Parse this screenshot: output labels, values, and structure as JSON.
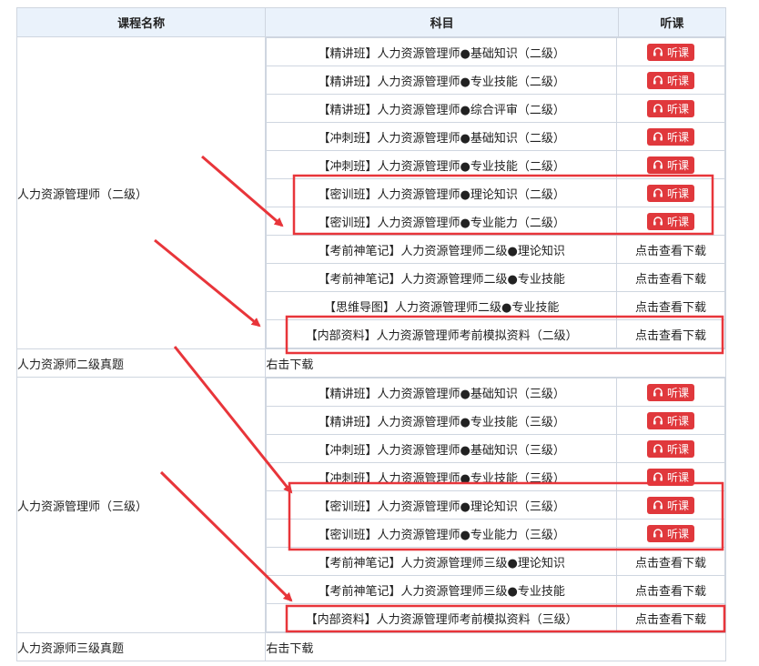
{
  "header": {
    "course_name": "课程名称",
    "subject": "科目",
    "listen": "听课"
  },
  "listen_label": "听课",
  "accent_color": "#e0383c",
  "groups": [
    {
      "name": "人力资源管理师（二级）",
      "rows": [
        {
          "subject": "【精讲班】人力资源管理师●基础知识（二级）",
          "action": "听课"
        },
        {
          "subject": "【精讲班】人力资源管理师●专业技能（二级）",
          "action": "听课"
        },
        {
          "subject": "【精讲班】人力资源管理师●综合评审（二级）",
          "action": "听课"
        },
        {
          "subject": "【冲刺班】人力资源管理师●基础知识（二级）",
          "action": "听课"
        },
        {
          "subject": "【冲刺班】人力资源管理师●专业技能（二级）",
          "action": "听课"
        },
        {
          "subject": "【密训班】人力资源管理师●理论知识（二级）",
          "action": "听课"
        },
        {
          "subject": "【密训班】人力资源管理师●专业能力（二级）",
          "action": "听课"
        },
        {
          "subject": "【考前神笔记】人力资源管理师二级●理论知识",
          "action": "点击查看下载"
        },
        {
          "subject": "【考前神笔记】人力资源管理师二级●专业技能",
          "action": "点击查看下载"
        },
        {
          "subject": "【思维导图】人力资源管理师二级●专业技能",
          "action": "点击查看下载"
        },
        {
          "subject": "【内部资料】人力资源管理师考前模拟资料（二级）",
          "action": "点击查看下载"
        }
      ]
    },
    {
      "exam_name": "人力资源师二级真题",
      "exam_link": "右击下载"
    },
    {
      "name": "人力资源管理师（三级）",
      "rows": [
        {
          "subject": "【精讲班】人力资源管理师●基础知识（三级）",
          "action": "听课"
        },
        {
          "subject": "【精讲班】人力资源管理师●专业技能（三级）",
          "action": "听课"
        },
        {
          "subject": "【冲刺班】人力资源管理师●基础知识（三级）",
          "action": "听课"
        },
        {
          "subject": "【冲刺班】人力资源管理师●专业技能（三级）",
          "action": "听课"
        },
        {
          "subject": "【密训班】人力资源管理师●理论知识（三级）",
          "action": "听课"
        },
        {
          "subject": "【密训班】人力资源管理师●专业能力（三级）",
          "action": "听课"
        },
        {
          "subject": "【考前神笔记】人力资源管理师三级●理论知识",
          "action": "点击查看下载"
        },
        {
          "subject": "【考前神笔记】人力资源管理师三级●专业技能",
          "action": "点击查看下载"
        },
        {
          "subject": "【内部资料】人力资源管理师考前模拟资料（三级）",
          "action": "点击查看下载"
        }
      ]
    },
    {
      "exam_name": "人力资源师三级真题",
      "exam_link": "右击下载"
    }
  ],
  "annotation_color": "#e8353a"
}
